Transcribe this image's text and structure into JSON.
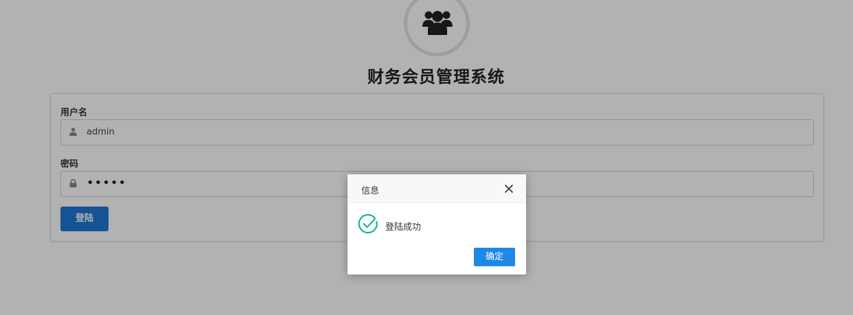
{
  "system_title": "财务会员管理系统",
  "logo": {
    "icon": "users-group-icon"
  },
  "login_form": {
    "username_label": "用户名",
    "username_value": "admin",
    "username_icon": "user-icon",
    "password_label": "密码",
    "password_value": "•••••",
    "password_icon": "lock-icon",
    "login_button": "登陆"
  },
  "dialog": {
    "title": "信息",
    "message": "登陆成功",
    "icon": "check-circle-icon",
    "confirm_button": "确定",
    "close_icon": "close-icon"
  },
  "colors": {
    "primary": "#1f77d6",
    "success": "#16b69a",
    "overlay": "rgba(0,0,0,0.30)"
  }
}
